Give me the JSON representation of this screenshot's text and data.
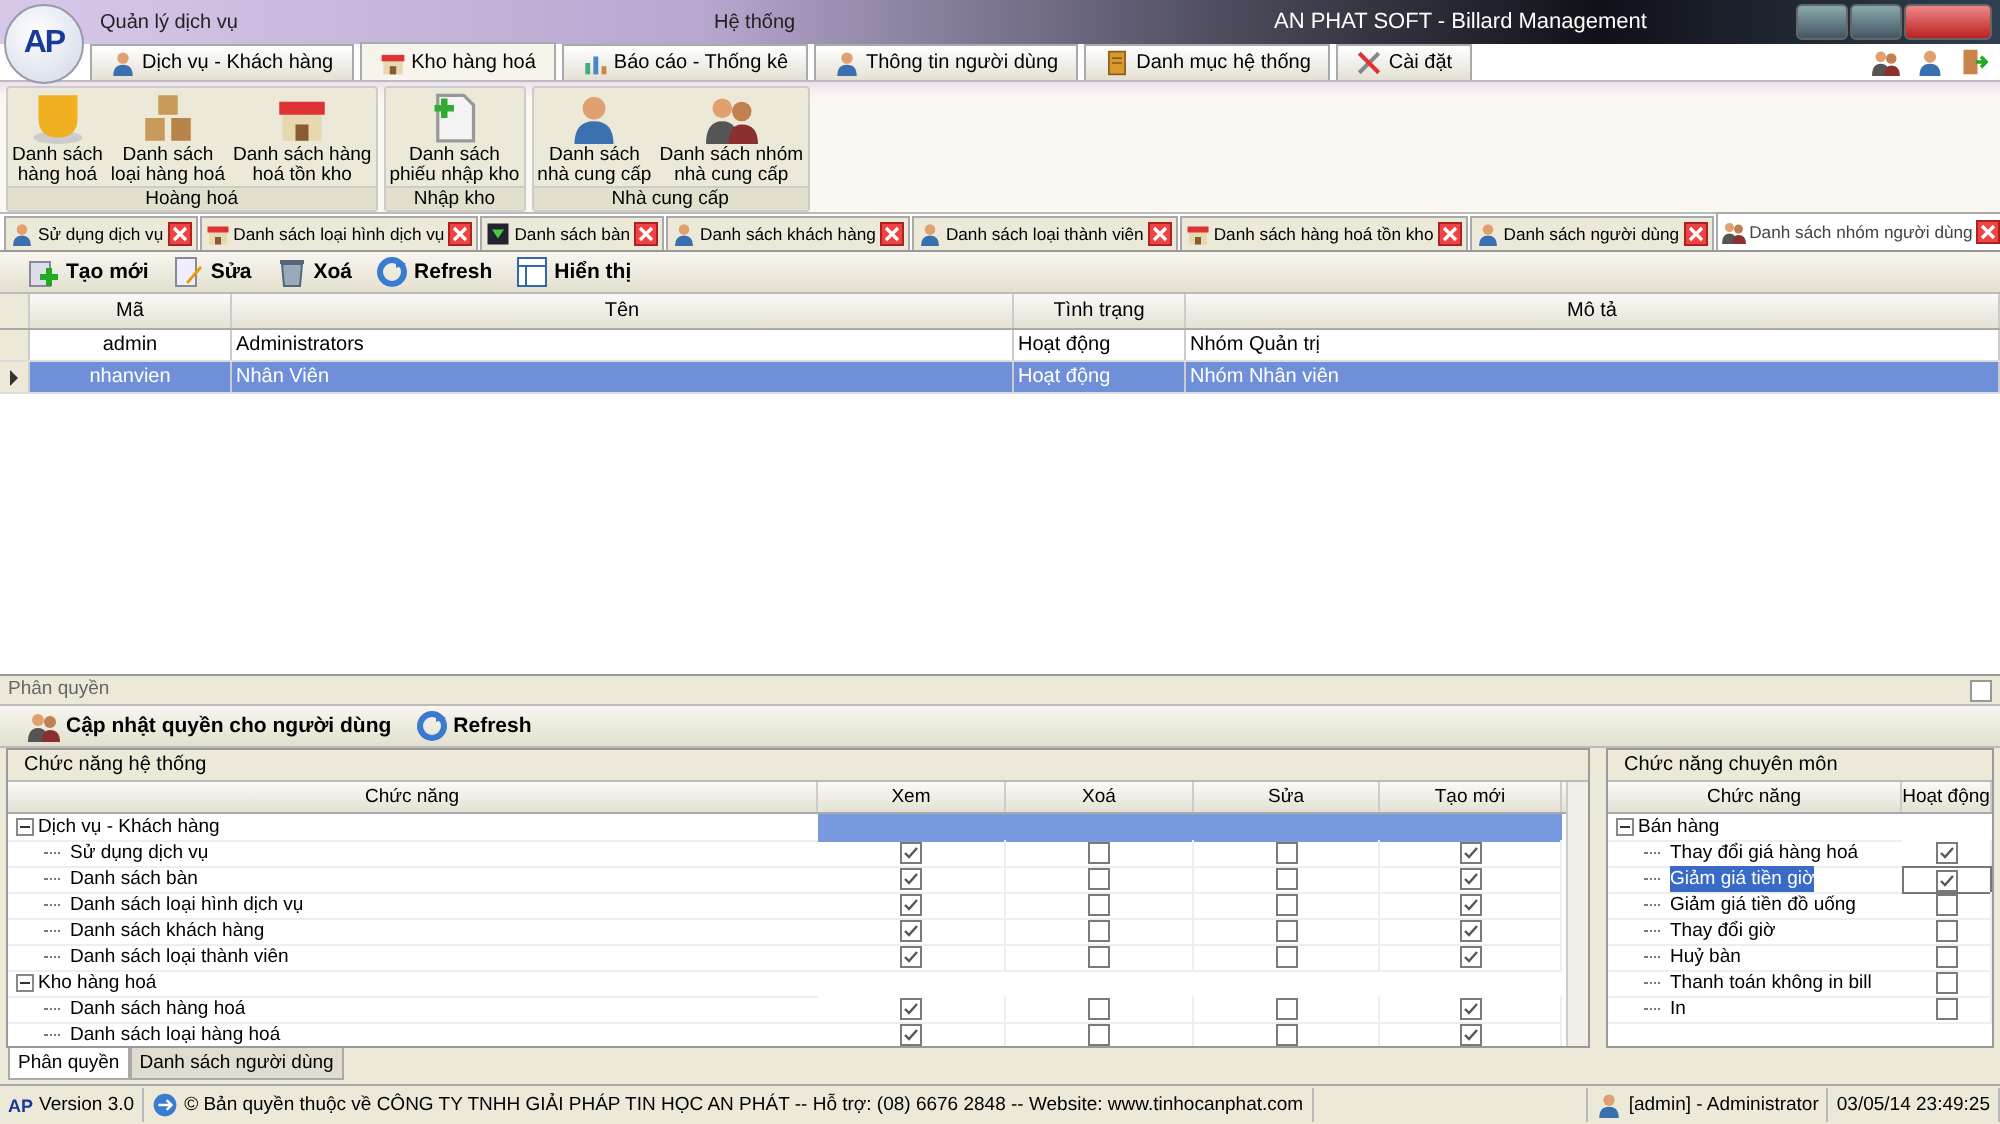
{
  "window": {
    "logo": "AP",
    "menu_groups": [
      "Quản lý dịch vụ",
      "Hệ thống"
    ],
    "title": "AN PHAT SOFT - Billard Management"
  },
  "ribbon_tabs": [
    {
      "label": "Dịch vụ - Khách hàng",
      "selected": false,
      "kind": "person"
    },
    {
      "label": "Kho hàng hoá",
      "selected": true,
      "kind": "store"
    },
    {
      "label": "Báo cáo - Thống kê",
      "selected": false,
      "kind": "chart"
    },
    {
      "label": "Thông tin người dùng",
      "selected": false,
      "kind": "person"
    },
    {
      "label": "Danh mục hệ thống",
      "selected": false,
      "kind": "book"
    },
    {
      "label": "Cài đặt",
      "selected": false,
      "kind": "tools"
    }
  ],
  "ribbon_groups": [
    {
      "title": "Hoàng hoá",
      "buttons": [
        {
          "label": "Danh sách\nhàng hoá",
          "kind": "cup"
        },
        {
          "label": "Danh sách\nloại hàng hoá",
          "kind": "box"
        },
        {
          "label": "Danh sách hàng\nhoá tồn kho",
          "kind": "store"
        }
      ]
    },
    {
      "title": "Nhập kho",
      "buttons": [
        {
          "label": "Danh sách\nphiếu nhập kho",
          "kind": "doc"
        }
      ]
    },
    {
      "title": "Nhà cung cấp",
      "buttons": [
        {
          "label": "Danh sách\nnhà cung cấp",
          "kind": "person"
        },
        {
          "label": "Danh sách nhóm\nnhà cung cấp",
          "kind": "group"
        }
      ]
    }
  ],
  "document_tabs": [
    {
      "label": "Sử dụng dịch vụ",
      "selected": false,
      "kind": "person"
    },
    {
      "label": "Danh sách loại hình dịch vụ",
      "selected": false,
      "kind": "store"
    },
    {
      "label": "Danh sách bàn",
      "selected": false,
      "kind": "table"
    },
    {
      "label": "Danh sách khách hàng",
      "selected": false,
      "kind": "person"
    },
    {
      "label": "Danh sách loại thành viên",
      "selected": false,
      "kind": "person"
    },
    {
      "label": "Danh sách hàng hoá tồn kho",
      "selected": false,
      "kind": "store"
    },
    {
      "label": "Danh sách người dùng",
      "selected": false,
      "kind": "person"
    },
    {
      "label": "Danh sách nhóm người dùng",
      "selected": true,
      "kind": "group"
    }
  ],
  "toolbar": [
    {
      "label": "Tạo mới",
      "kind": "plus"
    },
    {
      "label": "Sửa",
      "kind": "edit"
    },
    {
      "label": "Xoá",
      "kind": "trash"
    },
    {
      "label": "Refresh",
      "kind": "refresh"
    },
    {
      "label": "Hiển thị",
      "kind": "grid"
    }
  ],
  "groups_table": {
    "columns": [
      "Mã",
      "Tên",
      "Tình trạng",
      "Mô tả"
    ],
    "rows": [
      {
        "cells": [
          "admin",
          "Administrators",
          "Hoạt động",
          "Nhóm Quản trị"
        ],
        "selected": false
      },
      {
        "cells": [
          "nhanvien",
          "Nhân Viên",
          "Hoạt động",
          "Nhóm Nhân viên"
        ],
        "selected": true
      }
    ]
  },
  "permissions": {
    "title": "Phân quyền",
    "toolbar": [
      {
        "label": "Cập nhật quyền cho người dùng",
        "kind": "group"
      },
      {
        "label": "Refresh",
        "kind": "refresh"
      }
    ],
    "system_functions": {
      "title": "Chức năng hệ thống",
      "columns": [
        "Chức năng",
        "Xem",
        "Xoá",
        "Sửa",
        "Tạo mới"
      ],
      "groups": [
        {
          "label": "Dịch vụ - Khách hàng",
          "expanded": true,
          "selected": true,
          "children": [
            {
              "label": "Sử dụng dịch vụ",
              "checks": [
                true,
                false,
                false,
                true
              ]
            },
            {
              "label": "Danh sách bàn",
              "checks": [
                true,
                false,
                false,
                true
              ]
            },
            {
              "label": "Danh sách loại hình dịch vụ",
              "checks": [
                true,
                false,
                false,
                true
              ]
            },
            {
              "label": "Danh sách khách hàng",
              "checks": [
                true,
                false,
                false,
                true
              ]
            },
            {
              "label": "Danh sách loại thành viên",
              "checks": [
                true,
                false,
                false,
                true
              ]
            }
          ]
        },
        {
          "label": "Kho hàng hoá",
          "expanded": true,
          "selected": false,
          "children": [
            {
              "label": "Danh sách hàng hoá",
              "checks": [
                true,
                false,
                false,
                true
              ]
            },
            {
              "label": "Danh sách loại hàng hoá",
              "checks": [
                true,
                false,
                false,
                true
              ]
            }
          ]
        }
      ]
    },
    "special_functions": {
      "title": "Chức năng chuyên môn",
      "columns": [
        "Chức năng",
        "Hoạt động"
      ],
      "groups": [
        {
          "label": "Bán hàng",
          "expanded": true,
          "children": [
            {
              "label": "Thay đổi giá hàng hoá",
              "active": true,
              "selected": false
            },
            {
              "label": "Giảm giá tiền giờ",
              "active": true,
              "selected": true
            },
            {
              "label": "Giảm giá tiền đồ uống",
              "active": false,
              "selected": false
            },
            {
              "label": "Thay đổi giờ",
              "active": false,
              "selected": false
            },
            {
              "label": "Huỷ bàn",
              "active": false,
              "selected": false
            },
            {
              "label": "Thanh toán không in bill",
              "active": false,
              "selected": false
            },
            {
              "label": "In",
              "active": false,
              "selected": false
            }
          ]
        }
      ]
    }
  },
  "bottom_tabs": [
    {
      "label": "Phân quyền",
      "selected": true
    },
    {
      "label": "Danh sách người dùng",
      "selected": false
    }
  ],
  "status_bar": {
    "logo": "AP",
    "version": "Version 3.0",
    "copyright": "© Bản quyền thuộc về CÔNG TY TNHH GIẢI PHÁP TIN HỌC AN PHÁT  -- Hỗ trợ: (08) 6676 2848  -- Website: www.tinhocanphat.com",
    "user": "[admin] - Administrator",
    "datetime": "03/05/14 23:49:25"
  }
}
